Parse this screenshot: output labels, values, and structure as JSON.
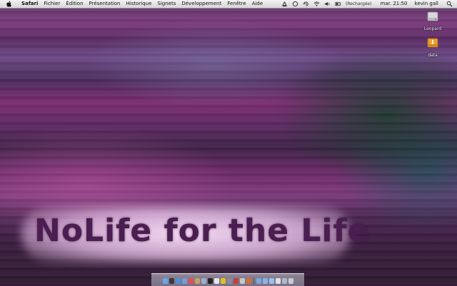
{
  "menubar": {
    "apple_icon": "apple-icon",
    "app_name": "Safari",
    "menus": [
      "Fichier",
      "Édition",
      "Présentation",
      "Historique",
      "Signets",
      "Développement",
      "Fenêtre",
      "Aide"
    ],
    "status": {
      "battery_state": "(Rechargée)",
      "clock": "mar. 21:50",
      "user": "kevin gall",
      "icons": [
        "display-icon",
        "sync-icon",
        "time-machine-icon",
        "wifi-icon",
        "volume-icon",
        "battery-icon",
        "spotlight-icon"
      ]
    }
  },
  "desktop": {
    "icons": [
      {
        "label": "Leopard",
        "icon": "hard-drive-icon"
      },
      {
        "label": "data",
        "icon": "external-drive-icon"
      }
    ],
    "wallpaper_text": "NoLife for the Life"
  },
  "dock": {
    "items": [
      {
        "name": "finder",
        "color": "#6aa6e8"
      },
      {
        "name": "dashboard",
        "color": "#3a3a3a"
      },
      {
        "name": "safari",
        "color": "#4f8fd6"
      },
      {
        "name": "itunes",
        "color": "#7a9ad8"
      },
      {
        "name": "ical",
        "color": "#e05050"
      },
      {
        "name": "address-book",
        "color": "#c8a060"
      },
      {
        "name": "preview",
        "color": "#9ab0c8"
      },
      {
        "name": "terminal",
        "color": "#222222"
      },
      {
        "name": "textedit",
        "color": "#e8e8e8"
      },
      {
        "name": "radiation",
        "color": "#e0c020"
      },
      {
        "name": "system-preferences",
        "color": "#8a8a9a"
      },
      {
        "name": "app-a",
        "color": "#c04040"
      },
      {
        "name": "app-b",
        "color": "#c8c8c8"
      },
      {
        "name": "app-c",
        "color": "#d07030"
      },
      {
        "name": "applications-folder",
        "color": "#7aa8e0"
      },
      {
        "name": "documents-folder",
        "color": "#8ab4e8"
      },
      {
        "name": "downloads-folder",
        "color": "#9ac0ec"
      },
      {
        "name": "stack-a",
        "color": "#e0e0e8"
      },
      {
        "name": "stack-b",
        "color": "#b0b8c8"
      },
      {
        "name": "trash",
        "color": "#c8ccd4"
      }
    ]
  }
}
